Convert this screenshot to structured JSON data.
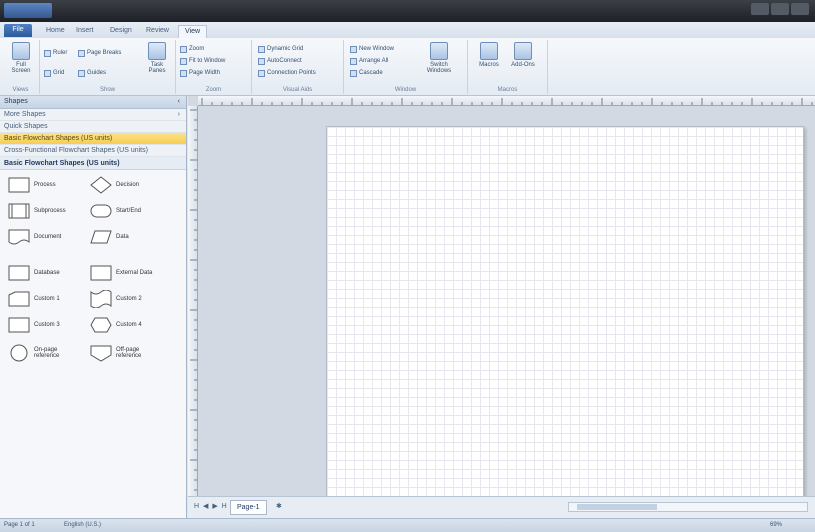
{
  "title_bar": {
    "title": ""
  },
  "tabs": [
    "File",
    "Home",
    "Insert",
    "Design",
    "Review",
    "View"
  ],
  "active_tab": "View",
  "ribbon": {
    "groups": [
      {
        "label": "Views",
        "big": [
          "Full Screen"
        ]
      },
      {
        "label": "Show",
        "small": [
          "Ruler",
          "Page Breaks",
          "Grid",
          "Guides"
        ],
        "big": [
          "Task Panes"
        ]
      },
      {
        "label": "Zoom",
        "small": [
          "Zoom",
          "Fit to Window",
          "Page Width"
        ]
      },
      {
        "label": "Visual Aids",
        "small": [
          "Dynamic Grid",
          "AutoConnect",
          "Connection Points"
        ]
      },
      {
        "label": "Window",
        "small": [
          "New Window",
          "Arrange All",
          "Cascade"
        ],
        "big": [
          "Switch Windows"
        ]
      },
      {
        "label": "Macros",
        "big": [
          "Macros",
          "Add-Ons"
        ]
      }
    ]
  },
  "shapes_pane": {
    "header": "Shapes",
    "rows": [
      "More Shapes",
      "Quick Shapes",
      "Basic Flowchart Shapes (US units)",
      "Cross-Functional Flowchart Shapes (US units)"
    ],
    "selected_index": 2,
    "stencil_title": "Basic Flowchart Shapes (US units)",
    "shapes": [
      {
        "name": "Process",
        "icon": "rect"
      },
      {
        "name": "Decision",
        "icon": "diamond"
      },
      {
        "name": "Subprocess",
        "icon": "subprocess"
      },
      {
        "name": "Start/End",
        "icon": "terminator"
      },
      {
        "name": "Document",
        "icon": "document"
      },
      {
        "name": "Data",
        "icon": "parallelogram"
      },
      {
        "name": "Database",
        "icon": "rect"
      },
      {
        "name": "External Data",
        "icon": "rect"
      },
      {
        "name": "Custom 1",
        "icon": "custom1"
      },
      {
        "name": "Custom 2",
        "icon": "custom2"
      },
      {
        "name": "Custom 3",
        "icon": "rect"
      },
      {
        "name": "Custom 4",
        "icon": "hexagon"
      },
      {
        "name": "On-page reference",
        "icon": "circle"
      },
      {
        "name": "Off-page reference",
        "icon": "offpage"
      }
    ]
  },
  "page_tabs": {
    "nav": "H ◀ ▶ H",
    "page": "Page-1",
    "add": "✱"
  },
  "status_bar": {
    "page": "Page 1 of 1",
    "language": "English (U.S.)",
    "zoom": "69%"
  }
}
